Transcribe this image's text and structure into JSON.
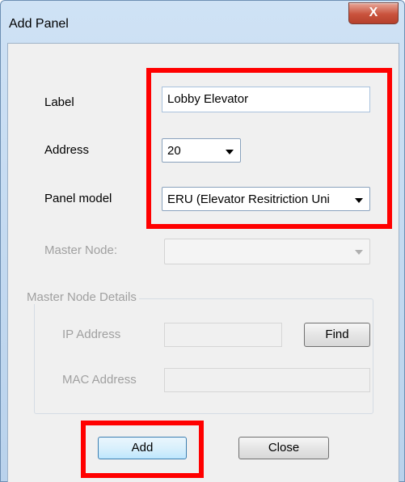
{
  "window": {
    "title": "Add Panel",
    "close_glyph": "X"
  },
  "form": {
    "label": {
      "caption": "Label",
      "value": "Lobby Elevator"
    },
    "address": {
      "caption": "Address",
      "value": "20"
    },
    "panel_model": {
      "caption": "Panel model",
      "value": "ERU (Elevator Resitriction Uni"
    },
    "master_node": {
      "caption": "Master Node:",
      "value": ""
    }
  },
  "master_node_details": {
    "title": "Master Node Details",
    "ip_address": {
      "caption": "IP Address",
      "value": ""
    },
    "find_label": "Find",
    "mac_address": {
      "caption": "MAC Address",
      "value": ""
    }
  },
  "buttons": {
    "add_label": "Add",
    "close_label": "Close"
  },
  "colors": {
    "highlight": "#ff0000"
  }
}
